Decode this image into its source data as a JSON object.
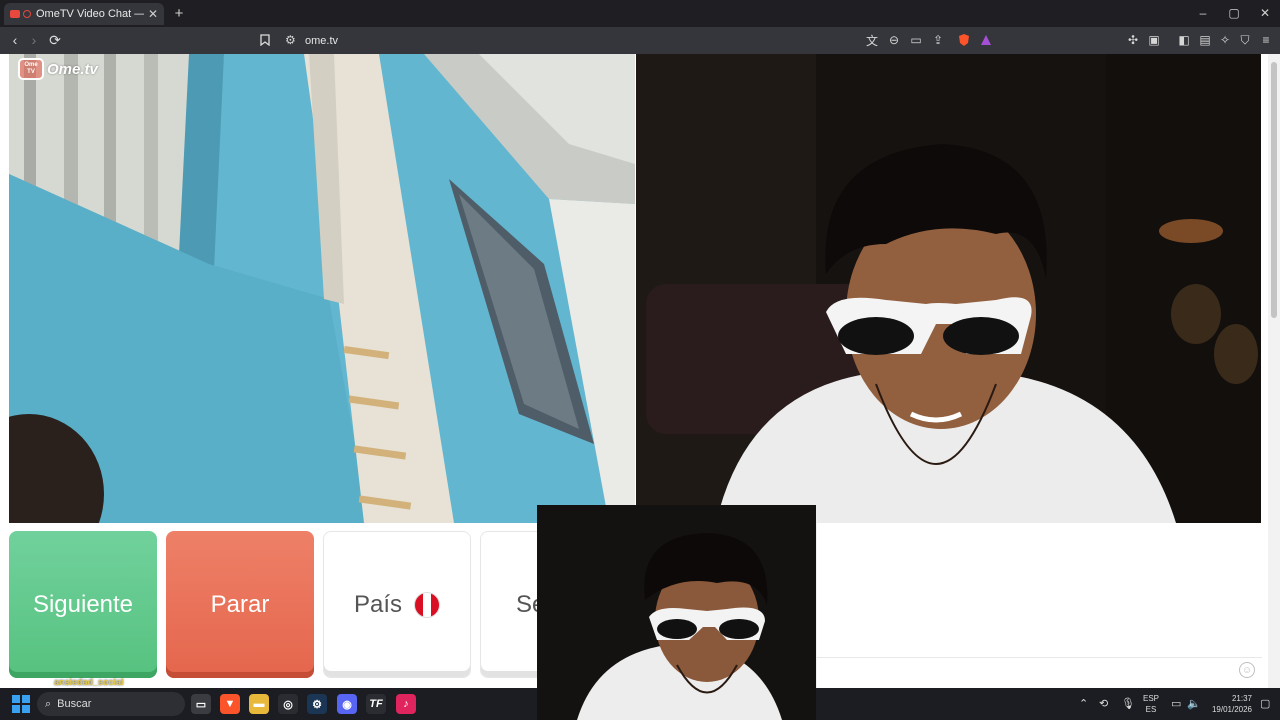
{
  "browser": {
    "tab_title": "OmeTV Video Chat — Omeg",
    "tab_close": "✕",
    "new_tab": "+",
    "url": "ome.tv",
    "window_controls": [
      "–",
      "▢",
      "✕"
    ]
  },
  "page": {
    "logo_badge": "Ome TV",
    "logo_text": "Ome.tv",
    "buttons": {
      "next": "Siguiente",
      "stop": "Parar",
      "country": "País",
      "sex": "Sexo"
    },
    "watermark": "ansiedad_social"
  },
  "taskbar": {
    "search_placeholder": "Buscar",
    "lang_top": "ESP",
    "lang_bottom": "ES",
    "time": "21:37",
    "date": "19/01/2026"
  },
  "colors": {
    "next": "#5ec986",
    "stop": "#e86f55",
    "peru_red": "#d91023"
  }
}
